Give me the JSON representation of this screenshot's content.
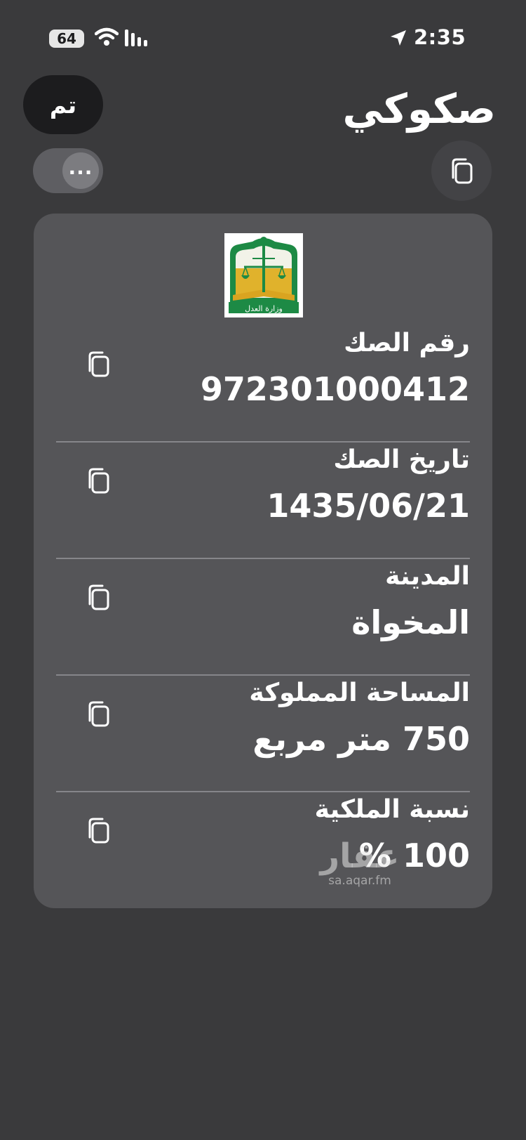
{
  "status_bar": {
    "battery_level": "64",
    "time": "2:35",
    "icons": [
      "wifi-icon",
      "signal-icon",
      "location-arrow-icon"
    ]
  },
  "header": {
    "done_label": "تم",
    "title": "صكوكي",
    "more_label": "..."
  },
  "deed": {
    "emblem": "ministry-of-justice-emblem",
    "emblem_text": "وزارة العدل",
    "fields": [
      {
        "label": "رقم الصك",
        "value": "972301000412"
      },
      {
        "label": "تاريخ الصك",
        "value": "1435/06/21"
      },
      {
        "label": "المدينة",
        "value": "المخواة"
      },
      {
        "label": "المساحة المملوكة",
        "value": "750 متر مربع"
      },
      {
        "label": "نسبة الملكية",
        "value": "100 %"
      }
    ]
  },
  "watermark": {
    "logo": "عقار",
    "url": "sa.aqar.fm"
  },
  "colors": {
    "background": "#3a3a3c",
    "card": "#555558",
    "button_dark": "#1c1c1e",
    "emblem_green": "#0f7a3c",
    "emblem_gold": "#d9a420"
  }
}
